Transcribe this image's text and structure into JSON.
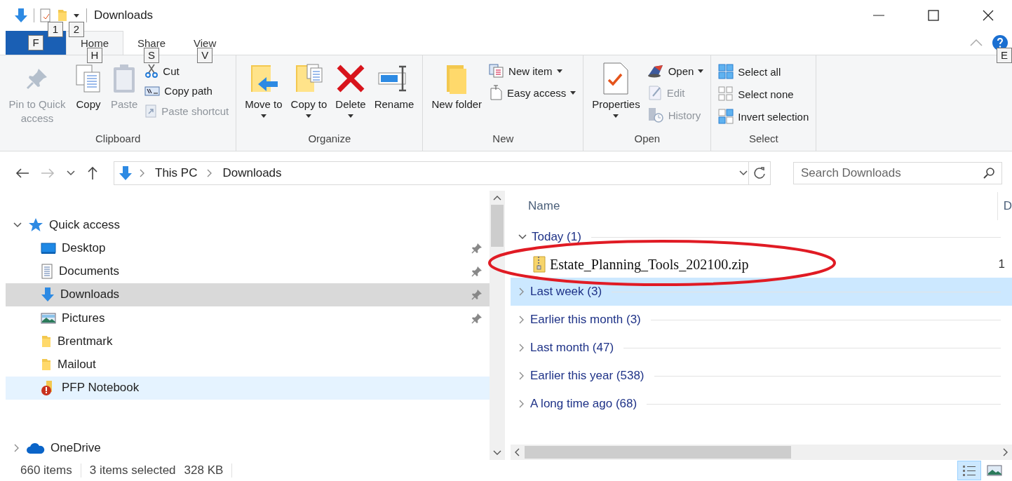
{
  "title_bar": {
    "title": "Downloads",
    "keytips": [
      "1",
      "2"
    ]
  },
  "ribbon": {
    "file_tab": {
      "keytip": "F"
    },
    "tabs": [
      {
        "label": "Home",
        "keytip": "H",
        "selected": true
      },
      {
        "label": "Share",
        "keytip": "S",
        "selected": false
      },
      {
        "label": "View",
        "keytip": "V",
        "selected": false
      }
    ],
    "help_keytip": "E",
    "groups": [
      {
        "label": "Clipboard",
        "items": [
          {
            "kind": "large",
            "label": "Pin to Quick access",
            "disabled": true,
            "dropdown": false
          },
          {
            "kind": "large",
            "label": "Copy",
            "disabled": false,
            "dropdown": false
          },
          {
            "kind": "large",
            "label": "Paste",
            "disabled": true,
            "dropdown": false
          },
          {
            "kind": "small",
            "label": "Cut",
            "disabled": false,
            "dropdown": false
          },
          {
            "kind": "small",
            "label": "Copy path",
            "disabled": false,
            "dropdown": false
          },
          {
            "kind": "small",
            "label": "Paste shortcut",
            "disabled": true,
            "dropdown": false
          }
        ]
      },
      {
        "label": "Organize",
        "items": [
          {
            "kind": "large",
            "label": "Move to",
            "disabled": false,
            "dropdown": true
          },
          {
            "kind": "large",
            "label": "Copy to",
            "disabled": false,
            "dropdown": true
          },
          {
            "kind": "large",
            "label": "Delete",
            "disabled": false,
            "dropdown": true
          },
          {
            "kind": "large",
            "label": "Rename",
            "disabled": false,
            "dropdown": false
          }
        ]
      },
      {
        "label": "New",
        "items": [
          {
            "kind": "large",
            "label": "New folder",
            "disabled": false,
            "dropdown": false
          },
          {
            "kind": "small",
            "label": "New item",
            "disabled": false,
            "dropdown": true
          },
          {
            "kind": "small",
            "label": "Easy access",
            "disabled": false,
            "dropdown": true
          }
        ]
      },
      {
        "label": "Open",
        "items": [
          {
            "kind": "large",
            "label": "Properties",
            "disabled": false,
            "dropdown": true
          },
          {
            "kind": "small",
            "label": "Open",
            "disabled": false,
            "dropdown": true
          },
          {
            "kind": "small",
            "label": "Edit",
            "disabled": true,
            "dropdown": false
          },
          {
            "kind": "small",
            "label": "History",
            "disabled": true,
            "dropdown": false
          }
        ]
      },
      {
        "label": "Select",
        "items": [
          {
            "kind": "small",
            "label": "Select all",
            "disabled": false,
            "dropdown": false
          },
          {
            "kind": "small",
            "label": "Select none",
            "disabled": false,
            "dropdown": false
          },
          {
            "kind": "small",
            "label": "Invert selection",
            "disabled": false,
            "dropdown": false
          }
        ]
      }
    ]
  },
  "address_bar": {
    "breadcrumbs": [
      "This PC",
      "Downloads"
    ],
    "forward_disabled": true
  },
  "search": {
    "placeholder": "Search Downloads"
  },
  "navigation_pane": {
    "items": [
      {
        "label": "Quick access",
        "expanded": true,
        "children": [
          {
            "label": "Desktop",
            "pinned": true,
            "selected": false,
            "hovered": false
          },
          {
            "label": "Documents",
            "pinned": true,
            "selected": false,
            "hovered": false
          },
          {
            "label": "Downloads",
            "pinned": true,
            "selected": true,
            "hovered": false
          },
          {
            "label": "Pictures",
            "pinned": true,
            "selected": false,
            "hovered": false
          },
          {
            "label": "Brentmark",
            "pinned": false,
            "selected": false,
            "hovered": false
          },
          {
            "label": "Mailout",
            "pinned": false,
            "selected": false,
            "hovered": false
          },
          {
            "label": "PFP Notebook",
            "pinned": false,
            "selected": false,
            "hovered": true
          }
        ]
      },
      {
        "label": "OneDrive",
        "expanded": false
      }
    ]
  },
  "file_list": {
    "columns": [
      "Name",
      "D"
    ],
    "groups": [
      {
        "label": "Today (1)",
        "expanded": true,
        "selected": false,
        "files": [
          {
            "name": "Estate_Planning_Tools_202100.zip",
            "column_2": "1"
          }
        ]
      },
      {
        "label": "Last week (3)",
        "expanded": false,
        "selected": true
      },
      {
        "label": "Earlier this month (3)",
        "expanded": false,
        "selected": false
      },
      {
        "label": "Last month (47)",
        "expanded": false,
        "selected": false
      },
      {
        "label": "Earlier this year (538)",
        "expanded": false,
        "selected": false
      },
      {
        "label": "A long time ago (68)",
        "expanded": false,
        "selected": false
      }
    ]
  },
  "status_bar": {
    "item_count": "660 items",
    "selection": "3 items selected",
    "size": "328 KB",
    "views": [
      {
        "kind": "details",
        "selected": true
      },
      {
        "kind": "large_icons",
        "selected": false
      }
    ]
  }
}
